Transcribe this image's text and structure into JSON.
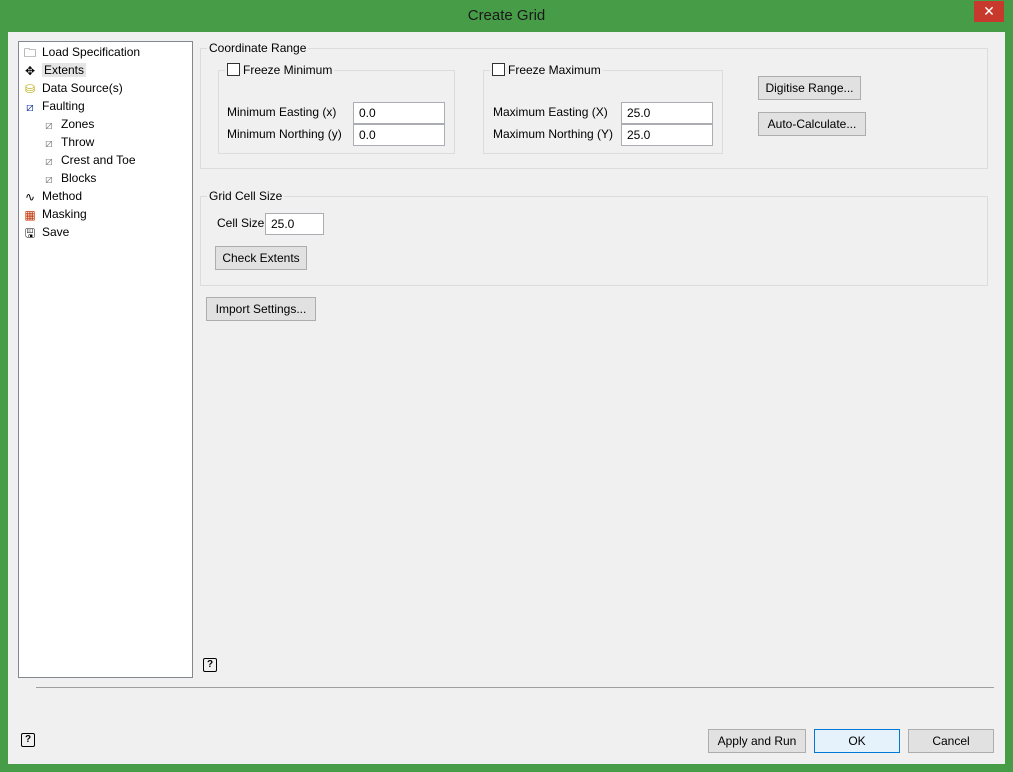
{
  "window": {
    "title": "Create Grid",
    "close": "✕"
  },
  "tree": [
    {
      "label": "Load Specification",
      "icon": "folder-icon"
    },
    {
      "label": "Extents",
      "icon": "move-arrows-icon",
      "selected": true
    },
    {
      "label": "Data Source(s)",
      "icon": "database-icon"
    },
    {
      "label": "Faulting",
      "icon": "fault-icon"
    },
    {
      "label": "Zones",
      "icon": "fault-icon",
      "child": true
    },
    {
      "label": "Throw",
      "icon": "fault-icon",
      "child": true
    },
    {
      "label": "Crest and Toe",
      "icon": "fault-icon",
      "child": true
    },
    {
      "label": "Blocks",
      "icon": "fault-icon",
      "child": true
    },
    {
      "label": "Method",
      "icon": "curve-icon"
    },
    {
      "label": "Masking",
      "icon": "grid-mask-icon"
    },
    {
      "label": "Save",
      "icon": "save-icon"
    }
  ],
  "coord": {
    "title": "Coordinate Range",
    "freeze_min": "Freeze Minimum",
    "freeze_max": "Freeze Maximum",
    "min_easting_label": "Minimum Easting (x)",
    "min_easting": "0.0",
    "min_northing_label": "Minimum Northing (y)",
    "min_northing": "0.0",
    "max_easting_label": "Maximum Easting (X)",
    "max_easting": "25.0",
    "max_northing_label": "Maximum Northing (Y)",
    "max_northing": "25.0",
    "digitise": "Digitise Range...",
    "auto": "Auto-Calculate..."
  },
  "cell": {
    "title": "Grid Cell Size",
    "label": "Cell Size",
    "value": "25.0",
    "check": "Check Extents"
  },
  "import": "Import Settings...",
  "help": "?",
  "footer": {
    "apply": "Apply and Run",
    "ok": "OK",
    "cancel": "Cancel"
  }
}
